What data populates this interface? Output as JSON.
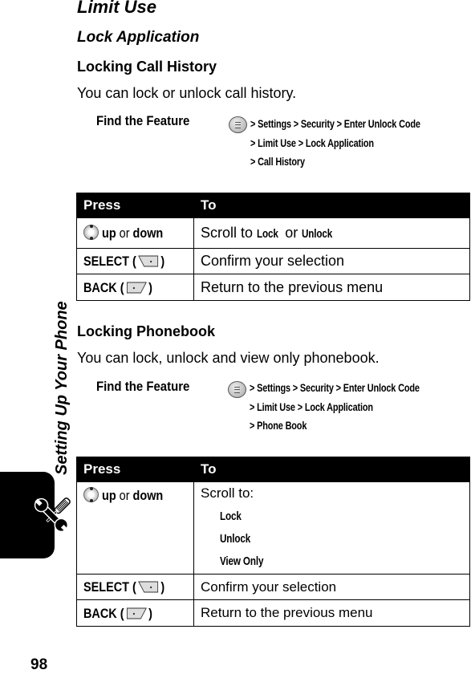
{
  "chapter": {
    "side_title": "Setting Up Your Phone",
    "icon": "tools-icon",
    "page_number": "98"
  },
  "headings": {
    "section": "Limit Use",
    "subsection": "Lock Application"
  },
  "call_history": {
    "title": "Locking Call History",
    "description": "You can lock or unlock call history.",
    "find_feature": {
      "label": "Find the Feature",
      "key_icon": "menu-key-icon",
      "path_lines": [
        "> Settings > Security > Enter Unlock Code",
        "> Limit Use > Lock Application",
        "> Call History"
      ]
    },
    "table": {
      "headers": [
        "Press",
        "To"
      ],
      "rows": [
        {
          "key_icon": "nav-key-icon",
          "press_a": "up",
          "press_or": " or ",
          "press_b": "down",
          "to_prefix": "Scroll to ",
          "to_term1": "Lock",
          "to_mid": " or ",
          "to_term2": "Unlock"
        },
        {
          "press": "SELECT (",
          "key_icon": "right-soft-key-icon",
          "press_end": ")",
          "to": "Confirm your selection"
        },
        {
          "press": "BACK (",
          "key_icon": "left-soft-key-icon",
          "press_end": ")",
          "to": "Return to the previous menu"
        }
      ]
    }
  },
  "phonebook": {
    "title": "Locking Phonebook",
    "description": "You can lock, unlock and view only phonebook.",
    "find_feature": {
      "label": "Find the Feature",
      "key_icon": "menu-key-icon",
      "path_lines": [
        "> Settings > Security > Enter Unlock Code",
        "> Limit Use > Lock Application",
        "> Phone Book"
      ]
    },
    "table": {
      "headers": [
        "Press",
        "To"
      ],
      "rows": [
        {
          "key_icon": "nav-key-icon",
          "press_a": "up",
          "press_or": " or ",
          "press_b": "down",
          "to_prefix": "Scroll to:",
          "options": [
            "Lock",
            "Unlock",
            "View Only"
          ]
        },
        {
          "press": "SELECT (",
          "key_icon": "right-soft-key-icon",
          "press_end": ")",
          "to": "Confirm your selection"
        },
        {
          "press": "BACK (",
          "key_icon": "left-soft-key-icon",
          "press_end": ")",
          "to": "Return to the previous menu"
        }
      ]
    }
  }
}
